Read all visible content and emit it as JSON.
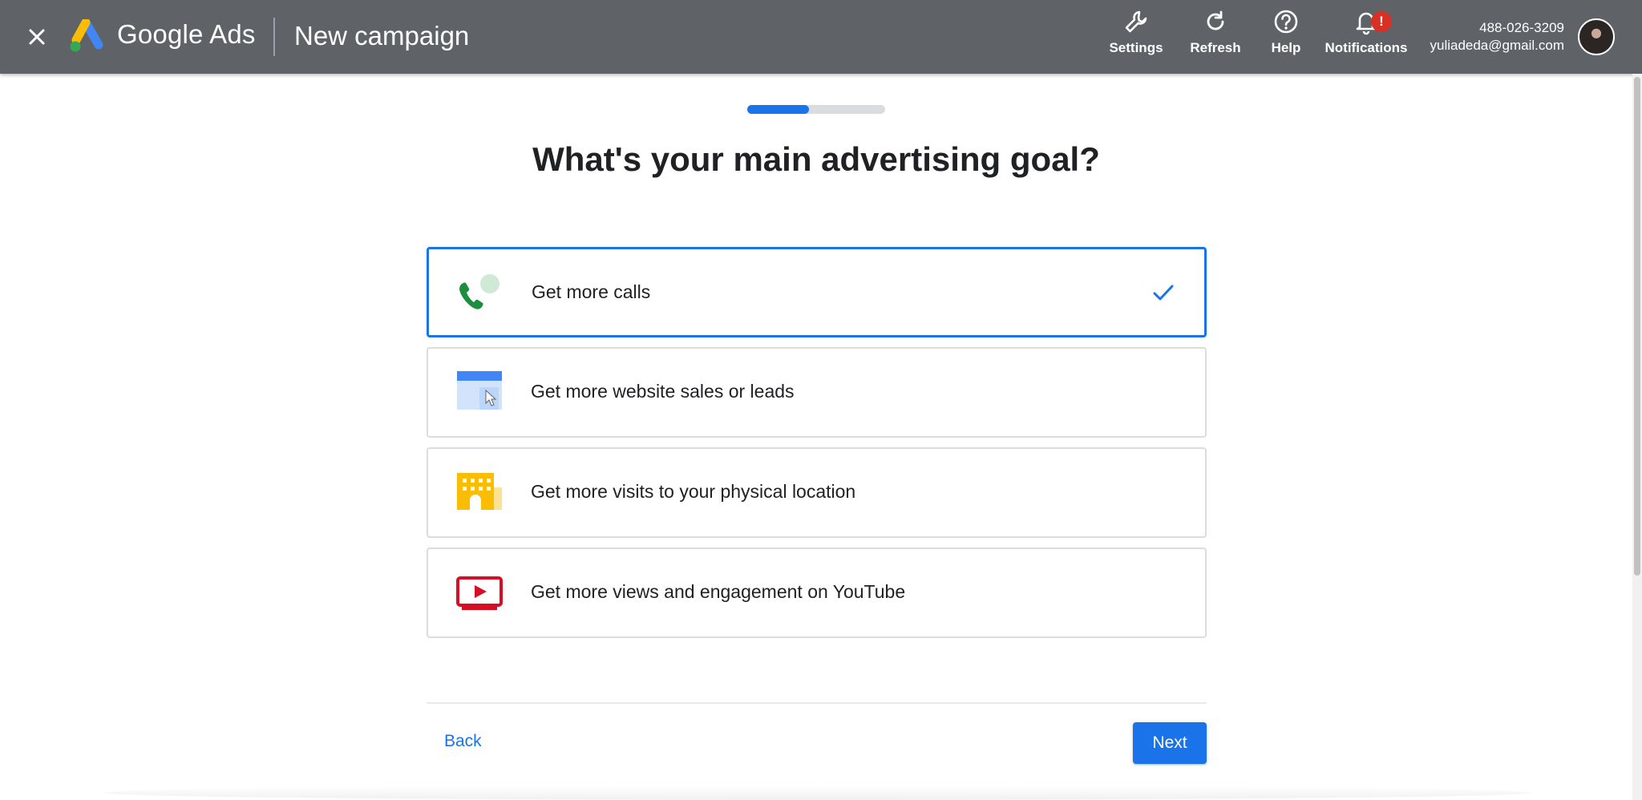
{
  "header": {
    "brand": "Google Ads",
    "title": "New campaign",
    "tools": {
      "settings": "Settings",
      "refresh": "Refresh",
      "help": "Help",
      "notifications": "Notifications",
      "notification_badge": "!"
    },
    "account": {
      "phone": "488-026-3209",
      "email": "yuliadeda@gmail.com"
    }
  },
  "progress": {
    "fraction": 0.45,
    "color": "#1a73e8"
  },
  "main": {
    "question": "What's your main advertising goal?",
    "options": [
      {
        "label": "Get more calls",
        "icon": "phone-chat-icon",
        "selected": true
      },
      {
        "label": "Get more website sales or leads",
        "icon": "website-cursor-icon",
        "selected": false
      },
      {
        "label": "Get more visits to your physical location",
        "icon": "building-icon",
        "selected": false
      },
      {
        "label": "Get more views and engagement on YouTube",
        "icon": "video-play-icon",
        "selected": false
      }
    ]
  },
  "footer": {
    "back": "Back",
    "next": "Next"
  },
  "colors": {
    "accent": "#1a73e8",
    "topbar": "#5f6368",
    "badge": "#d93025"
  }
}
